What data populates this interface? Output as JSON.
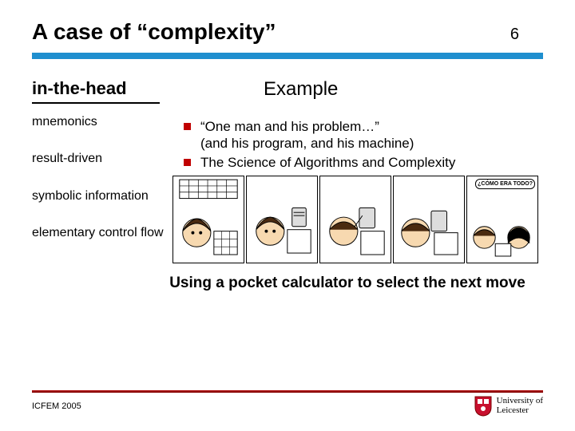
{
  "header": {
    "title": "A case of “complexity”",
    "page": "6"
  },
  "sidebar": {
    "heading": "in-the-head",
    "items": [
      "mnemonics",
      "result-driven",
      "symbolic information",
      "elementary control flow"
    ]
  },
  "main": {
    "heading": "Example",
    "bullets": [
      {
        "line1": "“One man and his problem…”",
        "line2": "(and his program, and his machine)"
      },
      {
        "line1": "The Science of Algorithms and Complexity",
        "line2": ""
      }
    ],
    "comic_bubble": "¿CÓMO ERA TODO?",
    "caption": "Using a pocket calculator to select the next move"
  },
  "footer": {
    "conference": "ICFEM 2005",
    "affiliation_line1": "University of",
    "affiliation_line2": "Leicester"
  }
}
